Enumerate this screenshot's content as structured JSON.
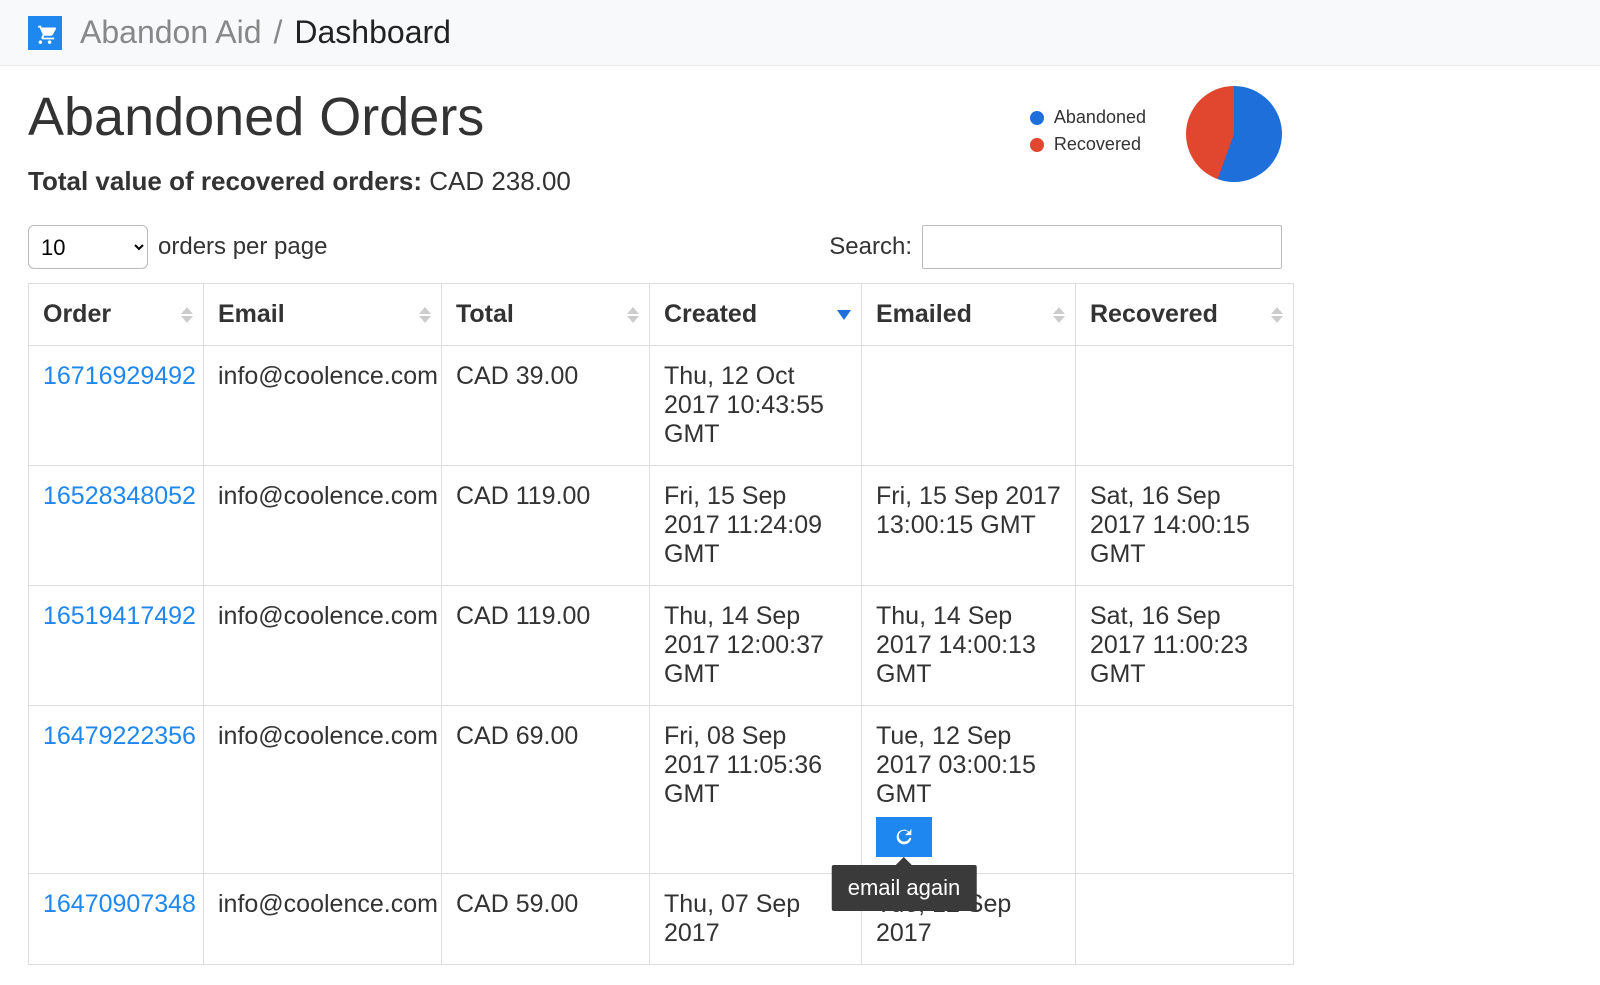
{
  "breadcrumb": {
    "app_name": "Abandon Aid",
    "separator": "/",
    "page": "Dashboard"
  },
  "page_title": "Abandoned Orders",
  "total_line": {
    "label": "Total value of recovered orders:",
    "value": "CAD 238.00"
  },
  "legend": {
    "abandoned": "Abandoned",
    "recovered": "Recovered",
    "abandoned_color": "#1e6fd9",
    "recovered_color": "#e0472e"
  },
  "chart_data": {
    "type": "pie",
    "title": "",
    "series": [
      {
        "name": "Abandoned",
        "value": 56,
        "color": "#1e6fd9"
      },
      {
        "name": "Recovered",
        "value": 44,
        "color": "#e0472e"
      }
    ]
  },
  "per_page": {
    "selected": "10",
    "suffix": "orders per page"
  },
  "search": {
    "label": "Search:",
    "value": ""
  },
  "columns": {
    "order": "Order",
    "email": "Email",
    "total": "Total",
    "created": "Created",
    "emailed": "Emailed",
    "recovered": "Recovered"
  },
  "rows": [
    {
      "order": "16716929492",
      "email": "info@coolence.com",
      "total": "CAD 39.00",
      "created": "Thu, 12 Oct 2017 10:43:55 GMT",
      "emailed": "",
      "recovered": "",
      "show_resend": false
    },
    {
      "order": "16528348052",
      "email": "info@coolence.com",
      "total": "CAD 119.00",
      "created": "Fri, 15 Sep 2017 11:24:09 GMT",
      "emailed": "Fri, 15 Sep 2017 13:00:15 GMT",
      "recovered": "Sat, 16 Sep 2017 14:00:15 GMT",
      "show_resend": false
    },
    {
      "order": "16519417492",
      "email": "info@coolence.com",
      "total": "CAD 119.00",
      "created": "Thu, 14 Sep 2017 12:00:37 GMT",
      "emailed": "Thu, 14 Sep 2017 14:00:13 GMT",
      "recovered": "Sat, 16 Sep 2017 11:00:23 GMT",
      "show_resend": false
    },
    {
      "order": "16479222356",
      "email": "info@coolence.com",
      "total": "CAD 69.00",
      "created": "Fri, 08 Sep 2017 11:05:36 GMT",
      "emailed": "Tue, 12 Sep 2017 03:00:15 GMT",
      "recovered": "",
      "show_resend": true
    },
    {
      "order": "16470907348",
      "email": "info@coolence.com",
      "total": "CAD 59.00",
      "created": "Thu, 07 Sep 2017",
      "emailed": "Tue, 12 Sep 2017",
      "recovered": "",
      "show_resend": false
    }
  ],
  "tooltip": "email again"
}
